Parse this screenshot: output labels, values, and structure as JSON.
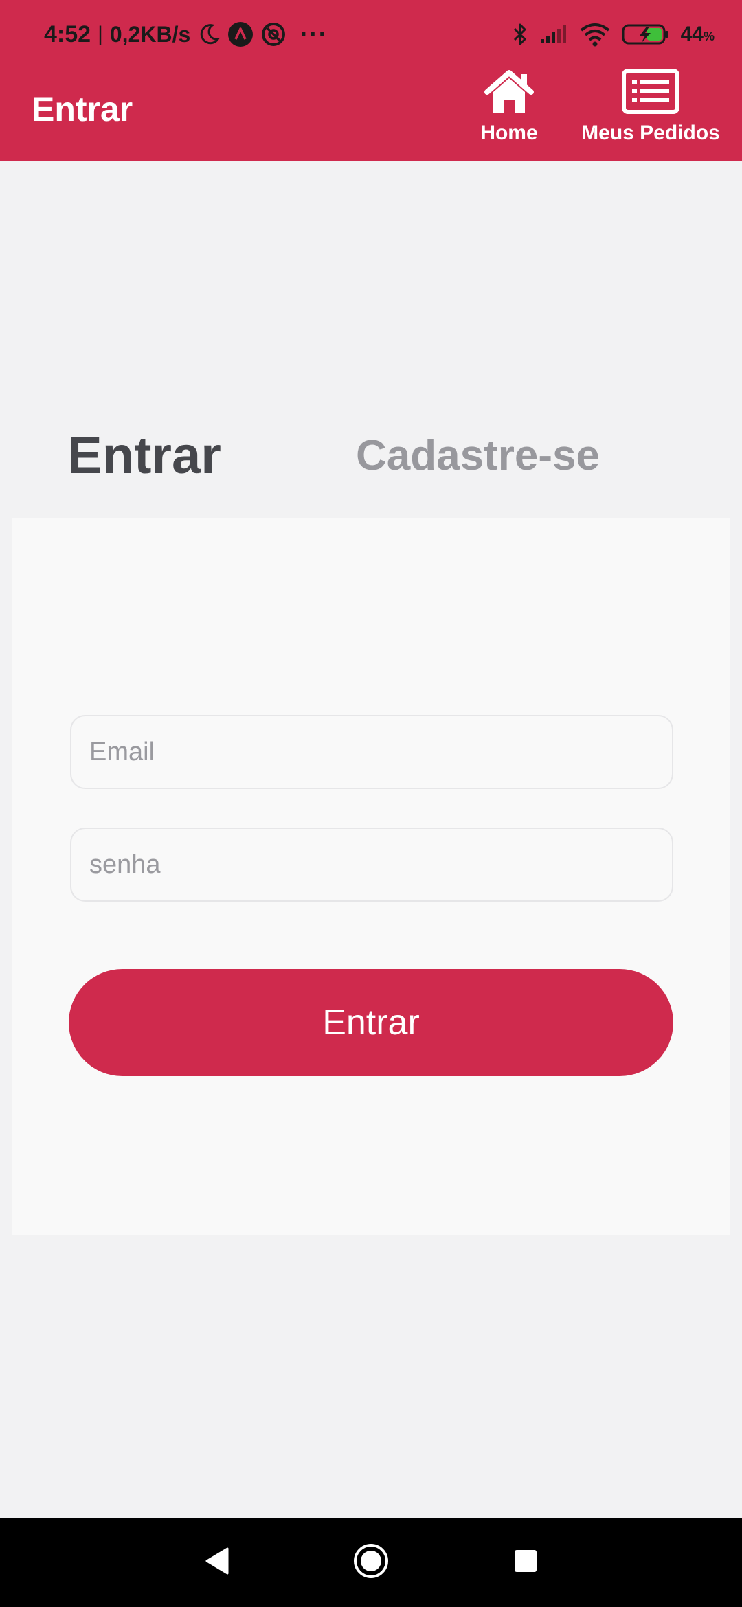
{
  "status_bar": {
    "time": "4:52",
    "separator": "|",
    "network_speed": "0,2KB/s",
    "more_indicator": "···",
    "battery_level": "44",
    "battery_unit": "%",
    "icons": [
      "moon-icon",
      "app-a-icon",
      "app-at-icon",
      "bluetooth-icon",
      "cellular-signal-icon",
      "wifi-icon",
      "battery-charging-icon"
    ]
  },
  "header": {
    "title": "Entrar",
    "nav": [
      {
        "label": "Home",
        "icon": "home-icon"
      },
      {
        "label": "Meus Pedidos",
        "icon": "list-icon"
      }
    ]
  },
  "tabs": [
    {
      "label": "Entrar",
      "active": true
    },
    {
      "label": "Cadastre-se",
      "active": false
    }
  ],
  "form": {
    "email_placeholder": "Email",
    "password_placeholder": "senha",
    "email_value": "",
    "password_value": "",
    "submit_label": "Entrar"
  },
  "navigation_bar": {
    "buttons": [
      "back-icon",
      "home-circle-icon",
      "recents-icon"
    ]
  },
  "colors": {
    "brand": "#cf2a4d",
    "background": "#f2f2f3",
    "card": "#f9f9f9",
    "tab_active": "#46474c",
    "tab_inactive": "#98989d"
  }
}
